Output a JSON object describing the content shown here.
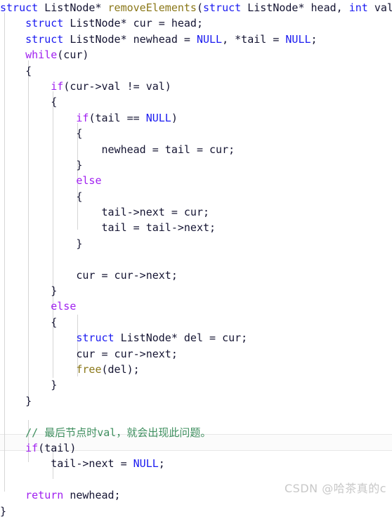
{
  "editor": {
    "language": "c",
    "background": "#ffffff",
    "current_line_index": 27,
    "colors": {
      "keyword": "#1a1af0",
      "control": "#a020f0",
      "function": "#8a7718",
      "identifier": "#141432",
      "comment": "#3f8f5f",
      "guide_line": "#d6d6d6",
      "current_line_bg": "#fbfbfb",
      "watermark": "#c8c8c8"
    }
  },
  "watermark": {
    "text": "CSDN @哈茶真的c"
  },
  "code_lines": [
    {
      "indent": 0,
      "text": "struct ListNode* removeElements(struct ListNode* head, int val){"
    },
    {
      "indent": 1,
      "text": "struct ListNode* cur = head;"
    },
    {
      "indent": 1,
      "text": "struct ListNode* newhead = NULL, *tail = NULL;"
    },
    {
      "indent": 1,
      "text": "while(cur)"
    },
    {
      "indent": 1,
      "text": "{"
    },
    {
      "indent": 2,
      "text": "if(cur->val != val)"
    },
    {
      "indent": 2,
      "text": "{"
    },
    {
      "indent": 3,
      "text": "if(tail == NULL)"
    },
    {
      "indent": 3,
      "text": "{"
    },
    {
      "indent": 4,
      "text": "newhead = tail = cur;"
    },
    {
      "indent": 3,
      "text": "}"
    },
    {
      "indent": 3,
      "text": "else"
    },
    {
      "indent": 3,
      "text": "{"
    },
    {
      "indent": 4,
      "text": "tail->next = cur;"
    },
    {
      "indent": 4,
      "text": "tail = tail->next;"
    },
    {
      "indent": 3,
      "text": "}"
    },
    {
      "indent": 0,
      "text": ""
    },
    {
      "indent": 3,
      "text": "cur = cur->next;"
    },
    {
      "indent": 2,
      "text": "}"
    },
    {
      "indent": 2,
      "text": "else"
    },
    {
      "indent": 2,
      "text": "{"
    },
    {
      "indent": 3,
      "text": "struct ListNode* del = cur;"
    },
    {
      "indent": 3,
      "text": "cur = cur->next;"
    },
    {
      "indent": 3,
      "text": "free(del);"
    },
    {
      "indent": 2,
      "text": "}"
    },
    {
      "indent": 1,
      "text": "}"
    },
    {
      "indent": 0,
      "text": ""
    },
    {
      "indent": 1,
      "text": "// 最后节点时val，就会出现此问题。"
    },
    {
      "indent": 1,
      "text": "if(tail)"
    },
    {
      "indent": 2,
      "text": "tail->next = NULL;"
    },
    {
      "indent": 0,
      "text": ""
    },
    {
      "indent": 1,
      "text": "return newhead;"
    },
    {
      "indent": 0,
      "text": "}"
    }
  ]
}
